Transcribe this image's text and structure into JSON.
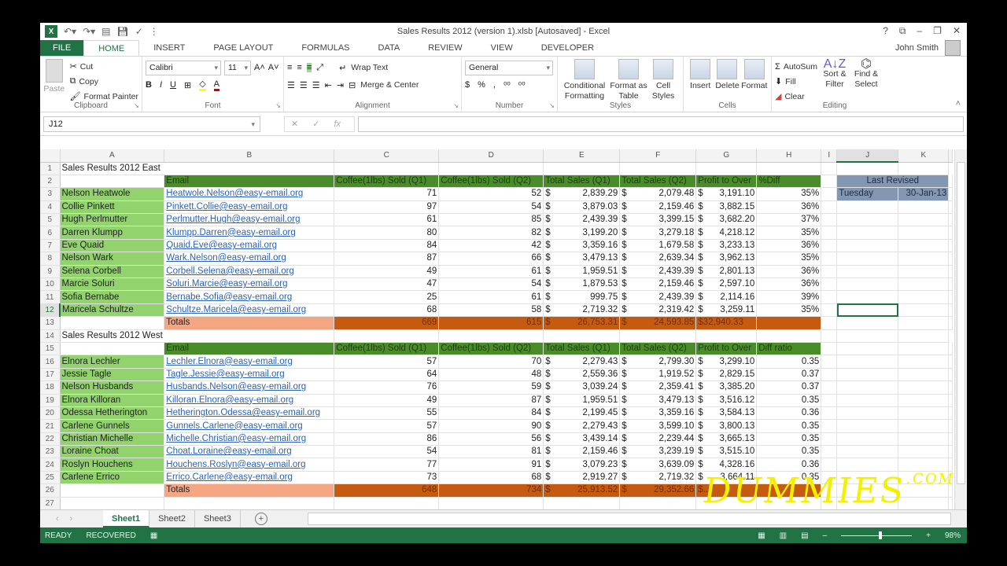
{
  "window": {
    "title": "Sales Results 2012 (version 1).xlsb [Autosaved] - Excel",
    "controls": [
      "?",
      "⧉",
      "–",
      "❐",
      "✕"
    ],
    "user": "John Smith"
  },
  "ribbon_tabs": [
    "FILE",
    "HOME",
    "INSERT",
    "PAGE LAYOUT",
    "FORMULAS",
    "DATA",
    "REVIEW",
    "VIEW",
    "DEVELOPER"
  ],
  "ribbon": {
    "clipboard": {
      "paste": "Paste",
      "cut": "Cut",
      "copy": "Copy",
      "format_painter": "Format Painter",
      "label": "Clipboard"
    },
    "font": {
      "name": "Calibri",
      "size": "11",
      "bold": "B",
      "italic": "I",
      "underline": "U",
      "label": "Font"
    },
    "alignment": {
      "wrap": "Wrap Text",
      "merge": "Merge & Center",
      "label": "Alignment"
    },
    "number": {
      "format": "General",
      "currency": "$",
      "percent": "%",
      "comma": ",",
      "label": "Number"
    },
    "styles": {
      "conditional": "Conditional Formatting",
      "format_table": "Format as Table",
      "cell_styles": "Cell Styles",
      "label": "Styles"
    },
    "cells": {
      "insert": "Insert",
      "delete": "Delete",
      "format": "Format",
      "label": "Cells"
    },
    "editing": {
      "autosum": "AutoSum",
      "fill": "Fill",
      "clear": "Clear",
      "sort": "Sort & Filter",
      "find": "Find & Select",
      "label": "Editing"
    }
  },
  "formula_bar": {
    "name_box": "J12",
    "formula": ""
  },
  "columns": [
    "A",
    "B",
    "C",
    "D",
    "E",
    "F",
    "G",
    "H",
    "I",
    "J",
    "K"
  ],
  "selected_cell": "J12",
  "east": {
    "title": "Sales Results 2012 East",
    "headers": [
      "Email",
      "Coffee(1lbs) Sold (Q1)",
      "Coffee(1lbs) Sold (Q2)",
      "Total Sales (Q1)",
      "Total Sales (Q2)",
      "Profit to Over",
      "%Diff"
    ],
    "rows": [
      {
        "name": "Nelson Heatwole",
        "email": "Heatwole.Nelson@easy-email.org",
        "q1": "71",
        "q2": "52",
        "s1": "2,839.29",
        "s2": "2,079.48",
        "profit": "3,191.10",
        "diff": "35%"
      },
      {
        "name": "Collie Pinkett",
        "email": "Pinkett.Collie@easy-email.org",
        "q1": "97",
        "q2": "54",
        "s1": "3,879.03",
        "s2": "2,159.46",
        "profit": "3,882.15",
        "diff": "36%"
      },
      {
        "name": "Hugh Perlmutter",
        "email": "Perlmutter.Hugh@easy-email.org",
        "q1": "61",
        "q2": "85",
        "s1": "2,439.39",
        "s2": "3,399.15",
        "profit": "3,682.20",
        "diff": "37%"
      },
      {
        "name": "Darren Klumpp",
        "email": "Klumpp.Darren@easy-email.org",
        "q1": "80",
        "q2": "82",
        "s1": "3,199.20",
        "s2": "3,279.18",
        "profit": "4,218.12",
        "diff": "35%"
      },
      {
        "name": "Eve Quaid",
        "email": "Quaid.Eve@easy-email.org",
        "q1": "84",
        "q2": "42",
        "s1": "3,359.16",
        "s2": "1,679.58",
        "profit": "3,233.13",
        "diff": "36%"
      },
      {
        "name": "Nelson Wark",
        "email": "Wark.Nelson@easy-email.org",
        "q1": "87",
        "q2": "66",
        "s1": "3,479.13",
        "s2": "2,639.34",
        "profit": "3,962.13",
        "diff": "35%"
      },
      {
        "name": "Selena Corbell",
        "email": "Corbell.Selena@easy-email.org",
        "q1": "49",
        "q2": "61",
        "s1": "1,959.51",
        "s2": "2,439.39",
        "profit": "2,801.13",
        "diff": "36%"
      },
      {
        "name": "Marcie Soluri",
        "email": "Soluri.Marcie@easy-email.org",
        "q1": "47",
        "q2": "54",
        "s1": "1,879.53",
        "s2": "2,159.46",
        "profit": "2,597.10",
        "diff": "36%"
      },
      {
        "name": "Sofia Bernabe",
        "email": "Bernabe.Sofia@easy-email.org",
        "q1": "25",
        "q2": "61",
        "s1": "999.75",
        "s2": "2,439.39",
        "profit": "2,114.16",
        "diff": "39%"
      },
      {
        "name": "Maricela Schultze",
        "email": "Schultze.Maricela@easy-email.org",
        "q1": "68",
        "q2": "58",
        "s1": "2,719.32",
        "s2": "2,319.42",
        "profit": "3,259.11",
        "diff": "35%"
      }
    ],
    "totals": {
      "label": "Totals",
      "q1": "669",
      "q2": "615",
      "s1": "26,753.31",
      "s2": "24,593.85",
      "profit": "$32,940.33"
    }
  },
  "west": {
    "title": "Sales Results 2012 West",
    "headers": [
      "Email",
      "Coffee(1lbs) Sold (Q1)",
      "Coffee(1lbs) Sold (Q2)",
      "Total Sales (Q1)",
      "Total Sales (Q2)",
      "Profit to Over",
      "Diff ratio"
    ],
    "rows": [
      {
        "name": "Elnora Lechler",
        "email": "Lechler.Elnora@easy-email.org",
        "q1": "57",
        "q2": "70",
        "s1": "2,279.43",
        "s2": "2,799.30",
        "profit": "3,299.10",
        "diff": "0.35"
      },
      {
        "name": "Jessie Tagle",
        "email": "Tagle.Jessie@easy-email.org",
        "q1": "64",
        "q2": "48",
        "s1": "2,559.36",
        "s2": "1,919.52",
        "profit": "2,829.15",
        "diff": "0.37"
      },
      {
        "name": "Nelson Husbands",
        "email": "Husbands.Nelson@easy-email.org",
        "q1": "76",
        "q2": "59",
        "s1": "3,039.24",
        "s2": "2,359.41",
        "profit": "3,385.20",
        "diff": "0.37"
      },
      {
        "name": "Elnora Killoran",
        "email": "Killoran.Elnora@easy-email.org",
        "q1": "49",
        "q2": "87",
        "s1": "1,959.51",
        "s2": "3,479.13",
        "profit": "3,516.12",
        "diff": "0.35"
      },
      {
        "name": "Odessa Hetherington",
        "email": "Hetherington.Odessa@easy-email.org",
        "q1": "55",
        "q2": "84",
        "s1": "2,199.45",
        "s2": "3,359.16",
        "profit": "3,584.13",
        "diff": "0.36"
      },
      {
        "name": "Carlene Gunnels",
        "email": "Gunnels.Carlene@easy-email.org",
        "q1": "57",
        "q2": "90",
        "s1": "2,279.43",
        "s2": "3,599.10",
        "profit": "3,800.13",
        "diff": "0.35"
      },
      {
        "name": "Christian Michelle",
        "email": "Michelle.Christian@easy-email.org",
        "q1": "86",
        "q2": "56",
        "s1": "3,439.14",
        "s2": "2,239.44",
        "profit": "3,665.13",
        "diff": "0.35"
      },
      {
        "name": "Loraine Choat",
        "email": "Choat.Loraine@easy-email.org",
        "q1": "54",
        "q2": "81",
        "s1": "2,159.46",
        "s2": "3,239.19",
        "profit": "3,515.10",
        "diff": "0.35"
      },
      {
        "name": "Roslyn Houchens",
        "email": "Houchens.Roslyn@easy-email.org",
        "q1": "77",
        "q2": "91",
        "s1": "3,079.23",
        "s2": "3,639.09",
        "profit": "4,328.16",
        "diff": "0.36"
      },
      {
        "name": "Carlene Errico",
        "email": "Errico.Carlene@easy-email.org",
        "q1": "73",
        "q2": "68",
        "s1": "2,919.27",
        "s2": "2,719.32",
        "profit": "3,664.11",
        "diff": "0.35"
      }
    ],
    "totals": {
      "label": "Totals",
      "q1": "648",
      "q2": "734",
      "s1": "25,913.52",
      "s2": "29,352.66",
      "profit": "$..."
    }
  },
  "last_revised": {
    "label": "Last Revised",
    "day": "Tuesday",
    "date": "30-Jan-13"
  },
  "sheet_tabs": [
    "Sheet1",
    "Sheet2",
    "Sheet3"
  ],
  "active_sheet": "Sheet1",
  "status": {
    "ready": "READY",
    "recovered": "RECOVERED",
    "zoom": "98%"
  },
  "watermark": {
    "text": "DUMMIES",
    "suffix": ".COM"
  },
  "colors": {
    "excel_green": "#217346",
    "header_green": "#4a8c2a",
    "name_green": "#92d36e",
    "totals_orange": "#c55a11",
    "totals_label": "#f4a582",
    "revised_blue": "#8497b0"
  }
}
